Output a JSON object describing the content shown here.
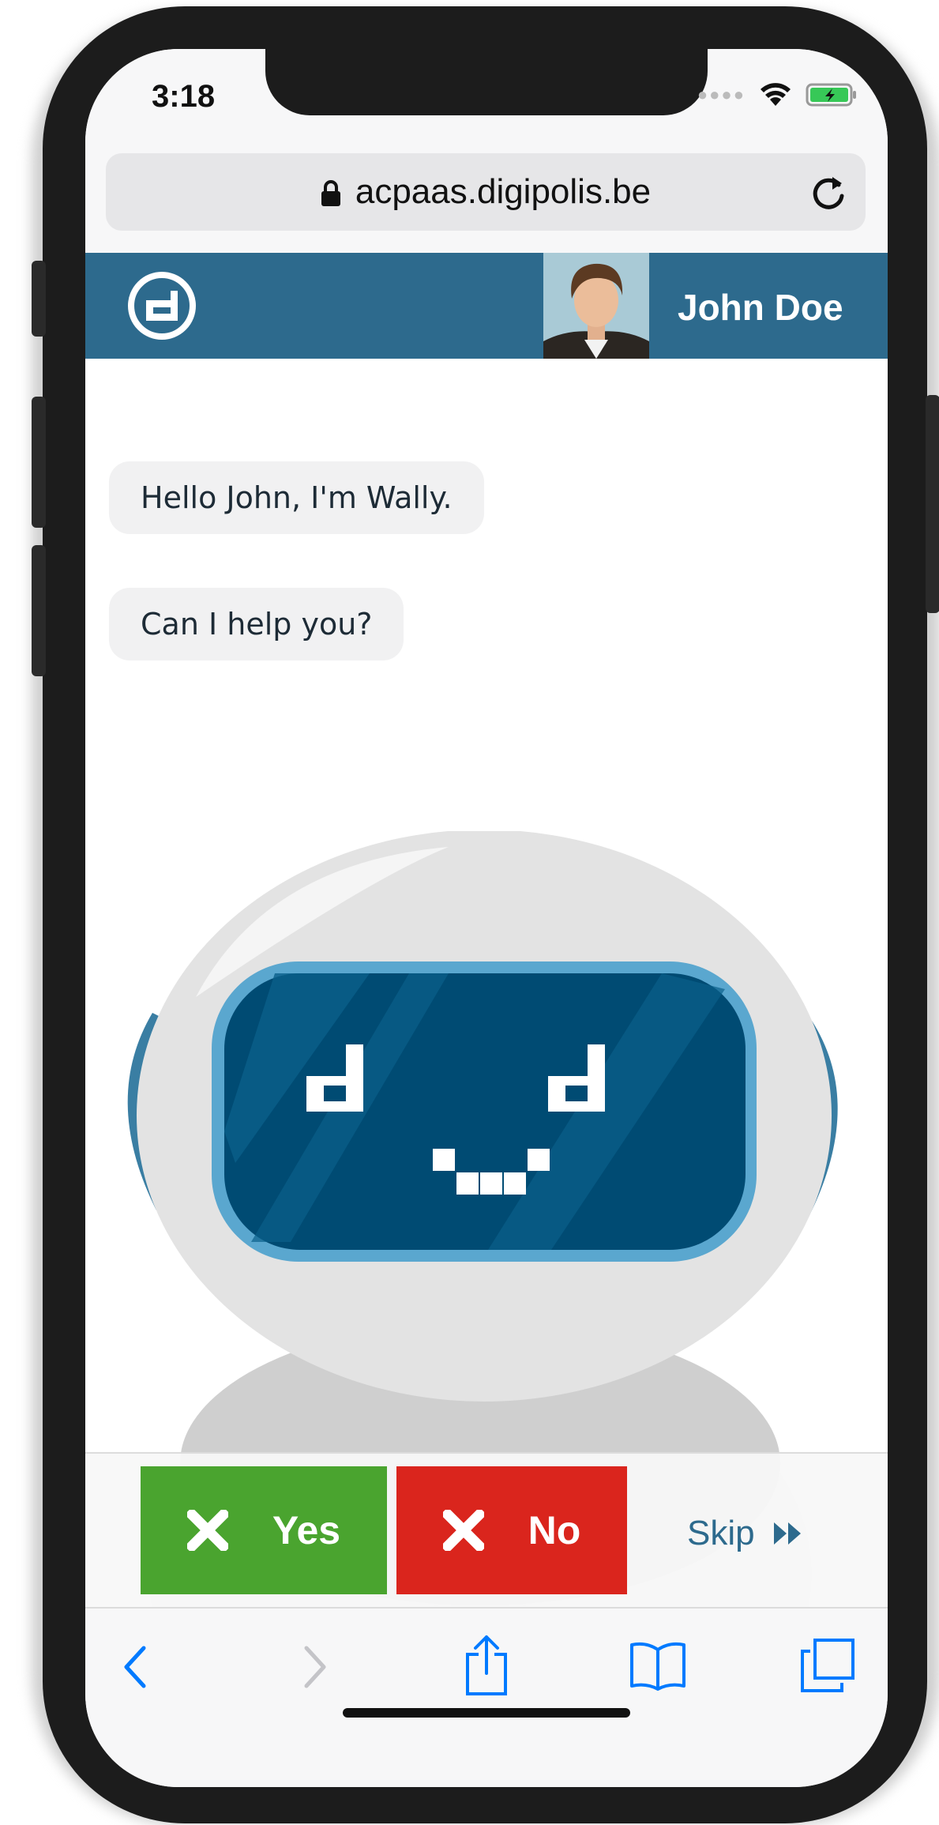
{
  "status_bar": {
    "time": "3:18"
  },
  "browser": {
    "url": "acpaas.digipolis.be"
  },
  "header": {
    "user_name": "John Doe"
  },
  "chat": {
    "messages": [
      "Hello John, I'm Wally.",
      "Can I help you?"
    ]
  },
  "actions": {
    "yes_label": "Yes",
    "no_label": "No",
    "skip_label": "Skip"
  },
  "colors": {
    "header": "#2d6a8d",
    "yes": "#4aa42f",
    "no": "#da251d",
    "visor": "#004b73",
    "accent": "#007aff"
  },
  "icons": [
    "lock-icon",
    "reload-icon",
    "digipolis-logo-icon",
    "close-icon",
    "fast-forward-icon",
    "back-icon",
    "forward-icon",
    "share-icon",
    "bookmarks-icon",
    "tabs-icon",
    "wifi-icon",
    "battery-icon"
  ]
}
